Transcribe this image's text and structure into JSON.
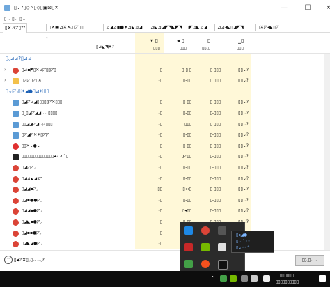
{
  "window": {
    "title": "▯⌄?▯◇⚬▯◇▯▣⊠▯✕",
    "minimize": "—",
    "maximize": "☐",
    "close": "✕"
  },
  "menu": [
    "▯⌄ ▯⌄ ▯⌄"
  ],
  "tabs": [
    "▯✕⊿◸▯⁇",
    "▯✕▬⊿✕✕◟▯◸▯▯",
    "⊿◢⊿▪●⁕⊿◣⊿◢",
    "⊿◣⊿◢◤◥◣◤◥",
    "▯◤⊿◣⊿◢",
    "⊿⊿◂◣▯◢◤◥",
    "▯✕◸◂◣▯◸"
  ],
  "header": {
    "sort_arrow": "⌃",
    "status_label": "▯⊿◣◥⁕?",
    "columns": [
      {
        "pct": "▾ ▯",
        "label": "▯▯▯"
      },
      {
        "pct": "◂ ▯",
        "label": "▯▯▯"
      },
      {
        "pct": "▯",
        "label": "▯▯◟▯"
      },
      {
        "pct": "_▯",
        "label": "▯▯▯"
      }
    ]
  },
  "rows": [
    {
      "type": "group",
      "label": "▯◟⊿⊿?▯⊿⊿",
      "c": [
        "",
        "",
        "",
        ""
      ]
    },
    {
      "type": "app",
      "icon": "chrome-icon",
      "color": "#db4437",
      "label": "▯⊿▪◤▯✕⊿◸▯▯◸▯",
      "c": [
        "-▯",
        "▯-▯ ▯",
        "▯ ▯▯▯",
        "▯▯⌄?"
      ]
    },
    {
      "type": "app",
      "icon": "explorer-icon",
      "color": "#f3c14b",
      "label": "▯◸◸▯◸▯✕",
      "c": [
        "-▯",
        "▯-▯▯",
        "▯ ▯▯▯",
        "▯▯⌄?"
      ]
    },
    {
      "type": "group",
      "label": "▯⌄◸◞▯✕◢●▯⊿✕▯▯",
      "c": [
        "",
        "",
        "",
        ""
      ]
    },
    {
      "type": "proc",
      "icon": "service-icon",
      "color": "#5b9bd5",
      "label": "▯◢◸⊿◢▯▯▯▯▯◸✕▯▯▯",
      "c": [
        "-▯",
        "▯-▯▯",
        "▯-▯▯▯",
        "▯▯⌄?"
      ]
    },
    {
      "type": "proc",
      "icon": "service-icon",
      "color": "#5b9bd5",
      "label": "▯_▯◢◸◢◢⌄⌄▯▯▯▯",
      "c": [
        "-▯",
        "▯-▯▯",
        "▯-▯▯▯",
        "▯▯⌄?"
      ]
    },
    {
      "type": "proc",
      "icon": "service-icon",
      "color": "#5b9bd5",
      "label": "▯▯◢◢◸◢⌄◸▯▯▯",
      "c": [
        "-▯",
        "▯▯▯",
        "▯ ▯▯▯",
        "▯▯⌄?"
      ]
    },
    {
      "type": "proc",
      "icon": "service-icon",
      "color": "#5b9bd5",
      "label": "▯◸◢◸✕⁕▯◸◸",
      "c": [
        "-▯",
        "▯-▯▯",
        "▯-▯▯▯",
        "▯▯⌄?"
      ]
    },
    {
      "type": "proc",
      "icon": "record-icon",
      "color": "#e03030",
      "label": "▯▯✕⌄●⌄",
      "c": [
        "-▯",
        "▯-▯▯",
        "▯-▯▯▯",
        "▯▯⌄?"
      ]
    },
    {
      "type": "proc",
      "icon": "terminal-icon",
      "color": "#222222",
      "label": "▯▯▯▯▯▯▯▯▯▯▯▯▯▯◂◸⊿⌃▯",
      "c": [
        "-▯",
        "▯◸▯▯",
        "▯-▯▯▯",
        "▯▯⌄?"
      ]
    },
    {
      "type": "proc",
      "icon": "chrome-icon",
      "color": "#db4437",
      "label": "▯◢◸◸◞",
      "c": [
        "-▯",
        "▯-▯▯",
        "▯-▯▯▯",
        "▯▯⌄?"
      ]
    },
    {
      "type": "proc",
      "icon": "chrome-icon",
      "color": "#db4437",
      "label": "▯◢⊿◣◢◞◸",
      "c": [
        "-▯",
        "▯-▯▯",
        "▯-▯▯▯",
        "▯▯⌄?"
      ]
    },
    {
      "type": "proc",
      "icon": "chrome-icon",
      "color": "#db4437",
      "label": "▯◢◢▪◸◞",
      "c": [
        "-▯▯",
        "▯◂◂▯",
        "▯-▯▯▯",
        "▯▯⌄?"
      ]
    },
    {
      "type": "proc",
      "icon": "chrome-icon",
      "color": "#db4437",
      "label": "▯◢▪●●◸◞",
      "c": [
        "-▯",
        "▯-▯▯",
        "▯-▯▯▯",
        "▯▯⌄?"
      ]
    },
    {
      "type": "proc",
      "icon": "chrome-icon",
      "color": "#db4437",
      "label": "▯◢◢▪●◸◞",
      "c": [
        "-▯",
        "▯◂▯▯",
        "▯-▯▯▯",
        "▯▯⌄?"
      ]
    },
    {
      "type": "proc",
      "icon": "chrome-icon",
      "color": "#db4437",
      "label": "▯◢◣▪●◸◞",
      "c": [
        "-▯",
        "▯-▯▯",
        "▯-▯▯▯",
        "▯▯⌄?"
      ]
    },
    {
      "type": "proc",
      "icon": "chrome-icon",
      "color": "#db4437",
      "label": "▯◢▪▪●◸◞",
      "c": [
        "-▯",
        "▯▯◂",
        "▯-▯▯▯",
        "▯▯⌄?"
      ]
    },
    {
      "type": "proc",
      "icon": "chrome-icon",
      "color": "#db4437",
      "label": "▯◢◣◢●◸◞",
      "c": [
        "-▯",
        "▯-▯▯",
        "▯-▯▯▯",
        "▯▯⌄?"
      ]
    }
  ],
  "footer": {
    "fewer_details": "▯◂◸✕▯◞▯⌄⌄◟?",
    "end_task": "▯▯◟▯⌄⌄"
  },
  "popup_icons": [
    "bluetooth-icon",
    "chrome-icon",
    "drive-icon",
    "battery-icon",
    "nvidia-icon",
    "onedrive-icon",
    "update-icon",
    "arrow-icon",
    "app-icon"
  ],
  "tooltip": {
    "line1": "▯◂◢●",
    "line2": "▯⌄⌃◦◦",
    "line3": "▯⌄◦◦⌃"
  },
  "taskbar": {
    "time": "▯▯▯▯▯▯",
    "date": "▯▯▯▯▯▯▯▯▯▯"
  }
}
